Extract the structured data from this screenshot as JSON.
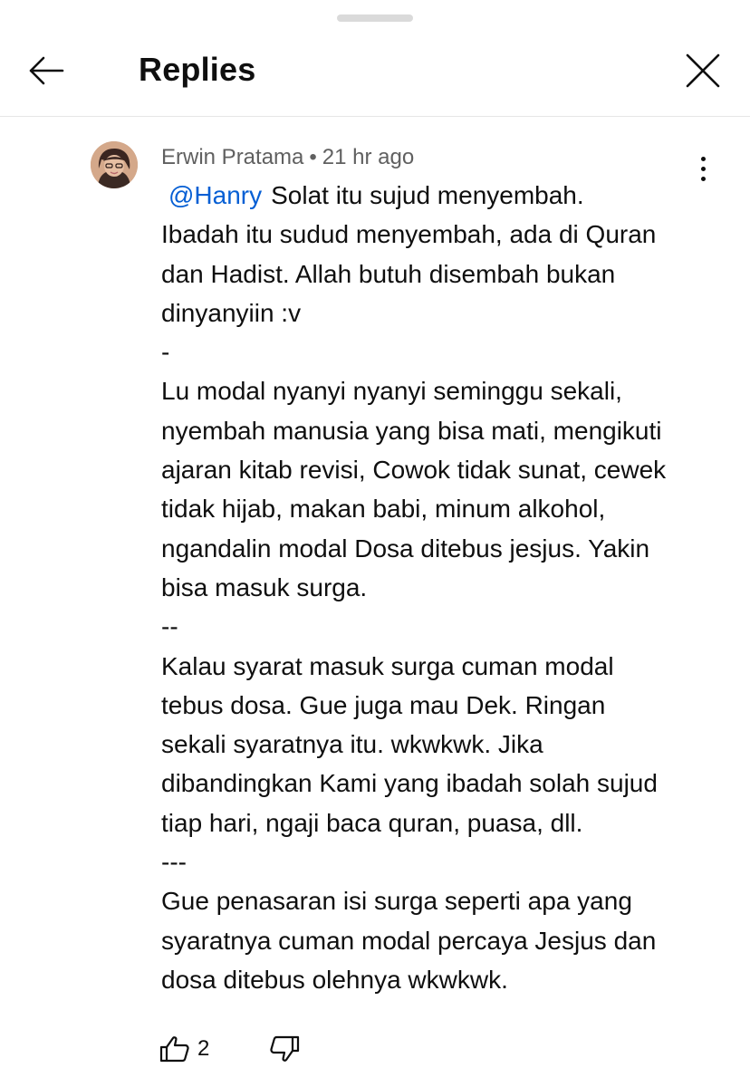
{
  "header": {
    "title": "Replies",
    "back_icon": "arrow-left-icon",
    "close_icon": "close-icon"
  },
  "comment": {
    "author": "Erwin Pratama",
    "separator": "•",
    "time": "21 hr ago",
    "mention": "@Hanry",
    "lines": [
      "Solat itu sujud menyembah.",
      "Ibadah itu sudud menyembah, ada di Quran",
      "dan Hadist. Allah butuh disembah bukan",
      "dinyanyiin :v",
      "-",
      "Lu modal nyanyi nyanyi seminggu sekali,",
      "nyembah manusia yang bisa mati, mengikuti",
      "ajaran kitab revisi, Cowok tidak sunat, cewek",
      "tidak hijab, makan babi, minum alkohol,",
      "ngandalin modal Dosa ditebus jesjus. Yakin",
      "bisa masuk surga.",
      "--",
      "Kalau syarat masuk surga cuman modal",
      "tebus dosa. Gue juga mau Dek. Ringan",
      "sekali syaratnya itu. wkwkwk. Jika",
      "dibandingkan Kami yang ibadah solah sujud",
      "tiap hari, ngaji baca quran, puasa, dll.",
      "---",
      "Gue penasaran isi surga seperti apa yang",
      "syaratnya cuman modal percaya Jesjus dan",
      "dosa ditebus olehnya wkwkwk."
    ],
    "like_count": "2",
    "icons": {
      "like": "thumbs-up-icon",
      "dislike": "thumbs-down-icon",
      "more": "more-vertical-icon"
    }
  },
  "colors": {
    "mention": "#065fd4",
    "meta": "#606060",
    "text": "#0f0f0f",
    "divider": "#e6e6e6"
  }
}
